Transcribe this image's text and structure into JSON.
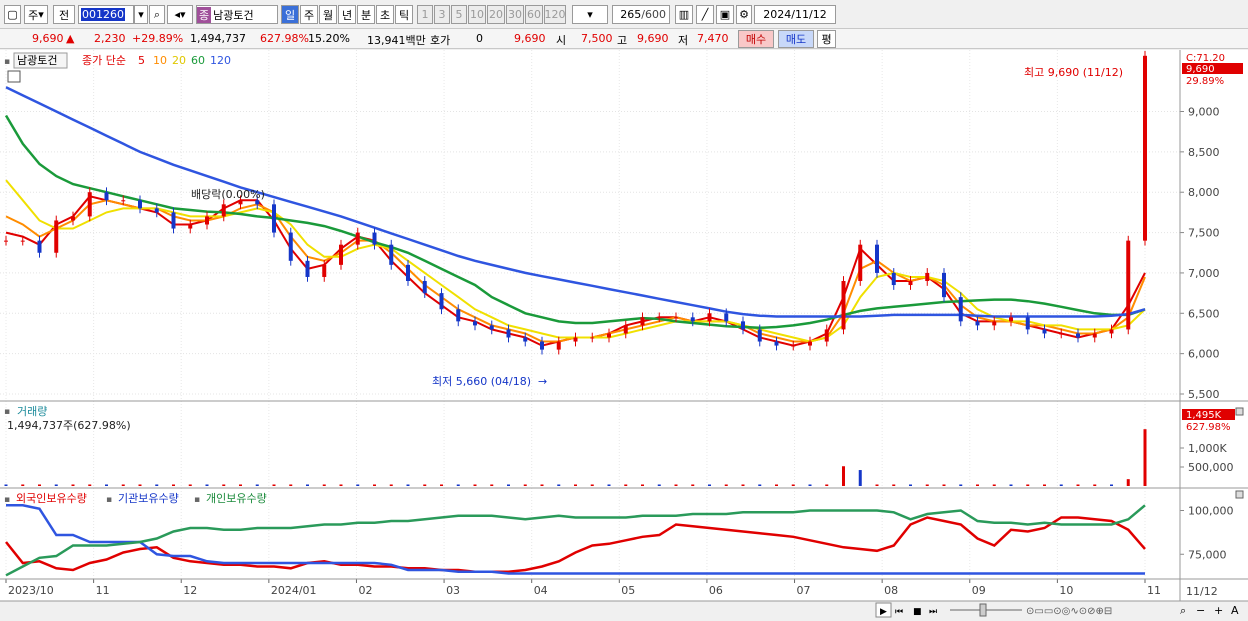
{
  "toolbar": {
    "market": "주",
    "prev": "전",
    "code": "001260",
    "stock_name": "남광토건",
    "tabs": [
      "일",
      "주",
      "월",
      "년",
      "분",
      "초",
      "틱"
    ],
    "active_tab": "일",
    "intervals": [
      "1",
      "3",
      "5",
      "10",
      "20",
      "30",
      "60",
      "120"
    ],
    "count": "265",
    "count_total": "/600",
    "date": "2024/11/12"
  },
  "quote": {
    "price": "9,690",
    "change": "2,230",
    "change_pct": "+29.89%",
    "volume": "1,494,737",
    "vol_ratio": "627.98%",
    "turnover": "15.20%",
    "amount": "13,941백만",
    "bid_label": "호가",
    "bid_value": "0",
    "ask_price": "9,690",
    "open_label": "시",
    "open": "7,500",
    "high_label": "고",
    "high": "9,690",
    "low_label": "저",
    "low": "7,470",
    "buy_label": "매수",
    "sell_label": "매도",
    "eval_label": "평"
  },
  "colors": {
    "up": "#e00000",
    "down": "#1536c8",
    "ma5": "#e00000",
    "ma10": "#ff8c00",
    "ma20": "#f0e000",
    "ma60": "#1a9a3a",
    "ma120": "#2f55e0"
  },
  "price_panel": {
    "title": "남광토건",
    "legend": [
      "종가 단순",
      "5",
      "10",
      "20",
      "60",
      "120"
    ],
    "max_annotation": "최고 9,690 (11/12)",
    "min_annotation": "최저 5,660 (04/18)",
    "dividend_annotation": "배당락(0.00%)",
    "right_tags": [
      "C:71.20",
      "9,690",
      "29.89%"
    ]
  },
  "volume_panel": {
    "title": "거래량",
    "info": "1,494,737주(627.98%)",
    "right_tags": [
      "1,495K",
      "627.98%"
    ]
  },
  "holder_panel": {
    "legend": [
      "외국인보유수량",
      "기관보유수량",
      "개인보유수량"
    ]
  },
  "chart_data": [
    {
      "type": "line",
      "title": "남광토건 일봉",
      "ylim": [
        5500,
        9700
      ],
      "yticks": [
        5500,
        6000,
        6500,
        7000,
        7500,
        8000,
        8500,
        9000
      ],
      "ytick_labels": [
        "5,500",
        "6,000",
        "6,500",
        "7,000",
        "7,500",
        "8,000",
        "8,500",
        "9,000"
      ],
      "x_labels": [
        "2023/10",
        "11",
        "12",
        "2024/01",
        "02",
        "03",
        "04",
        "05",
        "06",
        "07",
        "08",
        "09",
        "10",
        "11"
      ],
      "series": [
        {
          "name": "종가",
          "values": [
            7400,
            7400,
            7250,
            7650,
            7700,
            8000,
            7900,
            7900,
            7800,
            7750,
            7550,
            7600,
            7700,
            7850,
            7900,
            7850,
            7500,
            7150,
            6950,
            7100,
            7350,
            7500,
            7350,
            7100,
            6900,
            6750,
            6550,
            6400,
            6350,
            6300,
            6200,
            6150,
            6050,
            6150,
            6200,
            6200,
            6250,
            6350,
            6450,
            6450,
            6450,
            6400,
            6500,
            6400,
            6300,
            6150,
            6100,
            6100,
            6150,
            6300,
            6900,
            7350,
            7000,
            6850,
            6900,
            7000,
            6700,
            6400,
            6350,
            6400,
            6450,
            6300,
            6250,
            6250,
            6200,
            6250,
            6300,
            7400,
            9690
          ]
        },
        {
          "name": "5",
          "values": [
            7500,
            7450,
            7350,
            7600,
            7700,
            7950,
            7900,
            7850,
            7800,
            7750,
            7600,
            7600,
            7650,
            7800,
            7900,
            7900,
            7650,
            7300,
            7050,
            7100,
            7300,
            7450,
            7400,
            7150,
            6950,
            6750,
            6600,
            6450,
            6400,
            6300,
            6250,
            6200,
            6100,
            6150,
            6200,
            6200,
            6250,
            6350,
            6400,
            6450,
            6450,
            6400,
            6450,
            6400,
            6300,
            6200,
            6150,
            6100,
            6150,
            6250,
            6700,
            7300,
            7100,
            6900,
            6900,
            6950,
            6800,
            6500,
            6400,
            6400,
            6400,
            6350,
            6300,
            6250,
            6200,
            6250,
            6300,
            6600,
            7000
          ]
        },
        {
          "name": "10",
          "values": [
            7700,
            7600,
            7450,
            7550,
            7650,
            7850,
            7900,
            7850,
            7800,
            7800,
            7700,
            7650,
            7650,
            7700,
            7800,
            7850,
            7750,
            7450,
            7200,
            7150,
            7250,
            7400,
            7400,
            7250,
            7050,
            6850,
            6700,
            6550,
            6450,
            6350,
            6300,
            6250,
            6150,
            6150,
            6200,
            6200,
            6250,
            6300,
            6350,
            6400,
            6450,
            6400,
            6400,
            6400,
            6350,
            6250,
            6200,
            6150,
            6150,
            6200,
            6500,
            7050,
            7150,
            7000,
            6900,
            6950,
            6850,
            6600,
            6450,
            6400,
            6400,
            6350,
            6350,
            6300,
            6250,
            6250,
            6300,
            6450,
            6950
          ]
        },
        {
          "name": "20",
          "values": [
            8150,
            7900,
            7650,
            7550,
            7550,
            7650,
            7750,
            7800,
            7800,
            7800,
            7750,
            7700,
            7700,
            7700,
            7750,
            7800,
            7750,
            7600,
            7350,
            7200,
            7200,
            7300,
            7350,
            7300,
            7150,
            7000,
            6850,
            6700,
            6550,
            6450,
            6350,
            6300,
            6250,
            6200,
            6200,
            6200,
            6200,
            6250,
            6300,
            6350,
            6400,
            6400,
            6400,
            6400,
            6350,
            6300,
            6250,
            6200,
            6150,
            6200,
            6350,
            6700,
            6950,
            7000,
            6950,
            6950,
            6900,
            6750,
            6550,
            6450,
            6400,
            6400,
            6350,
            6350,
            6300,
            6300,
            6300,
            6350,
            6550
          ]
        },
        {
          "name": "60",
          "values": [
            8950,
            8600,
            8350,
            8200,
            8100,
            8050,
            8000,
            7950,
            7900,
            7850,
            7800,
            7780,
            7760,
            7750,
            7730,
            7700,
            7680,
            7650,
            7620,
            7580,
            7520,
            7450,
            7380,
            7320,
            7250,
            7150,
            7050,
            6950,
            6850,
            6700,
            6600,
            6500,
            6450,
            6400,
            6380,
            6380,
            6400,
            6420,
            6440,
            6430,
            6400,
            6380,
            6360,
            6340,
            6330,
            6320,
            6330,
            6350,
            6380,
            6420,
            6480,
            6530,
            6560,
            6580,
            6600,
            6620,
            6640,
            6650,
            6660,
            6670,
            6670,
            6650,
            6620,
            6580,
            6540,
            6500,
            6480,
            6480,
            6550
          ]
        },
        {
          "name": "120",
          "values": [
            9300,
            9200,
            9100,
            9000,
            8900,
            8800,
            8700,
            8600,
            8500,
            8420,
            8340,
            8270,
            8200,
            8130,
            8060,
            8000,
            7940,
            7880,
            7820,
            7760,
            7700,
            7630,
            7560,
            7490,
            7420,
            7350,
            7280,
            7210,
            7150,
            7100,
            7050,
            7000,
            6960,
            6920,
            6880,
            6840,
            6800,
            6760,
            6720,
            6680,
            6640,
            6600,
            6560,
            6520,
            6490,
            6470,
            6460,
            6460,
            6460,
            6460,
            6460,
            6460,
            6470,
            6480,
            6480,
            6480,
            6480,
            6480,
            6470,
            6460,
            6460,
            6460,
            6460,
            6460,
            6460,
            6460,
            6470,
            6490,
            6550
          ]
        }
      ]
    },
    {
      "type": "bar",
      "title": "거래량",
      "ylim": [
        0,
        1500000
      ],
      "yticks": [
        500000,
        1000000
      ],
      "ytick_labels": [
        "500,000",
        "1,000K"
      ],
      "spikes": [
        {
          "index": 50,
          "value": 520000
        },
        {
          "index": 51,
          "value": 420000
        },
        {
          "index": 67,
          "value": 180000
        },
        {
          "index": 68,
          "value": 1494737
        }
      ],
      "base": 40000
    },
    {
      "type": "line",
      "title": "보유수량",
      "ylim": [
        62000,
        106000
      ],
      "yticks": [
        75000,
        100000
      ],
      "ytick_labels": [
        "75,000",
        "100,000"
      ],
      "series": [
        {
          "name": "외국인보유수량",
          "values": [
            82000,
            70000,
            71000,
            67000,
            66000,
            70000,
            72000,
            76000,
            78000,
            79000,
            73000,
            71000,
            70000,
            69000,
            69000,
            68000,
            68000,
            67000,
            70000,
            71000,
            69000,
            69000,
            68000,
            68000,
            67000,
            67000,
            66000,
            66000,
            65000,
            65000,
            65000,
            66000,
            68000,
            71000,
            76000,
            80000,
            81000,
            83000,
            85000,
            86000,
            92000,
            91000,
            90000,
            89000,
            88000,
            87000,
            86000,
            85000,
            83000,
            81000,
            79000,
            78000,
            77000,
            80000,
            92000,
            96000,
            94000,
            92000,
            84000,
            80000,
            89000,
            88000,
            90000,
            96000,
            96000,
            95000,
            94000,
            89000,
            78000
          ]
        },
        {
          "name": "기관보유수량",
          "values": [
            103000,
            103000,
            101000,
            86000,
            86000,
            82000,
            82000,
            82000,
            82000,
            75000,
            74000,
            74000,
            71000,
            70000,
            70000,
            70000,
            70000,
            70000,
            70000,
            70000,
            70000,
            70000,
            70000,
            69000,
            66000,
            66000,
            66000,
            65000,
            65000,
            65000,
            64000,
            64000,
            64000,
            64000,
            64000,
            64000,
            64000,
            64000,
            64000,
            64000,
            64000,
            64000,
            64000,
            64000,
            64000,
            64000,
            64000,
            64000,
            64000,
            64000,
            64000,
            64000,
            64000,
            64000,
            64000,
            64000,
            64000,
            64000,
            64000,
            64000,
            64000,
            64000,
            64000,
            64000,
            64000,
            64000,
            64000,
            64000,
            64000
          ]
        },
        {
          "name": "개인보유수량",
          "values": [
            63000,
            68000,
            73000,
            74000,
            80000,
            80000,
            80000,
            81000,
            82000,
            84000,
            88000,
            90000,
            90000,
            89000,
            89000,
            90000,
            90000,
            90000,
            91000,
            92000,
            92000,
            93000,
            93000,
            94000,
            94000,
            95000,
            96000,
            97000,
            97000,
            97000,
            96000,
            95000,
            96000,
            97000,
            96000,
            96000,
            96000,
            96000,
            97000,
            97000,
            97000,
            98000,
            98000,
            98000,
            99000,
            99000,
            99000,
            99000,
            100000,
            100000,
            100000,
            100000,
            100000,
            99000,
            95000,
            98000,
            99000,
            100000,
            94000,
            93000,
            93000,
            92000,
            93000,
            92000,
            92000,
            92000,
            92000,
            95000,
            103000
          ]
        }
      ]
    }
  ],
  "status": {
    "end_label": "11/12"
  }
}
